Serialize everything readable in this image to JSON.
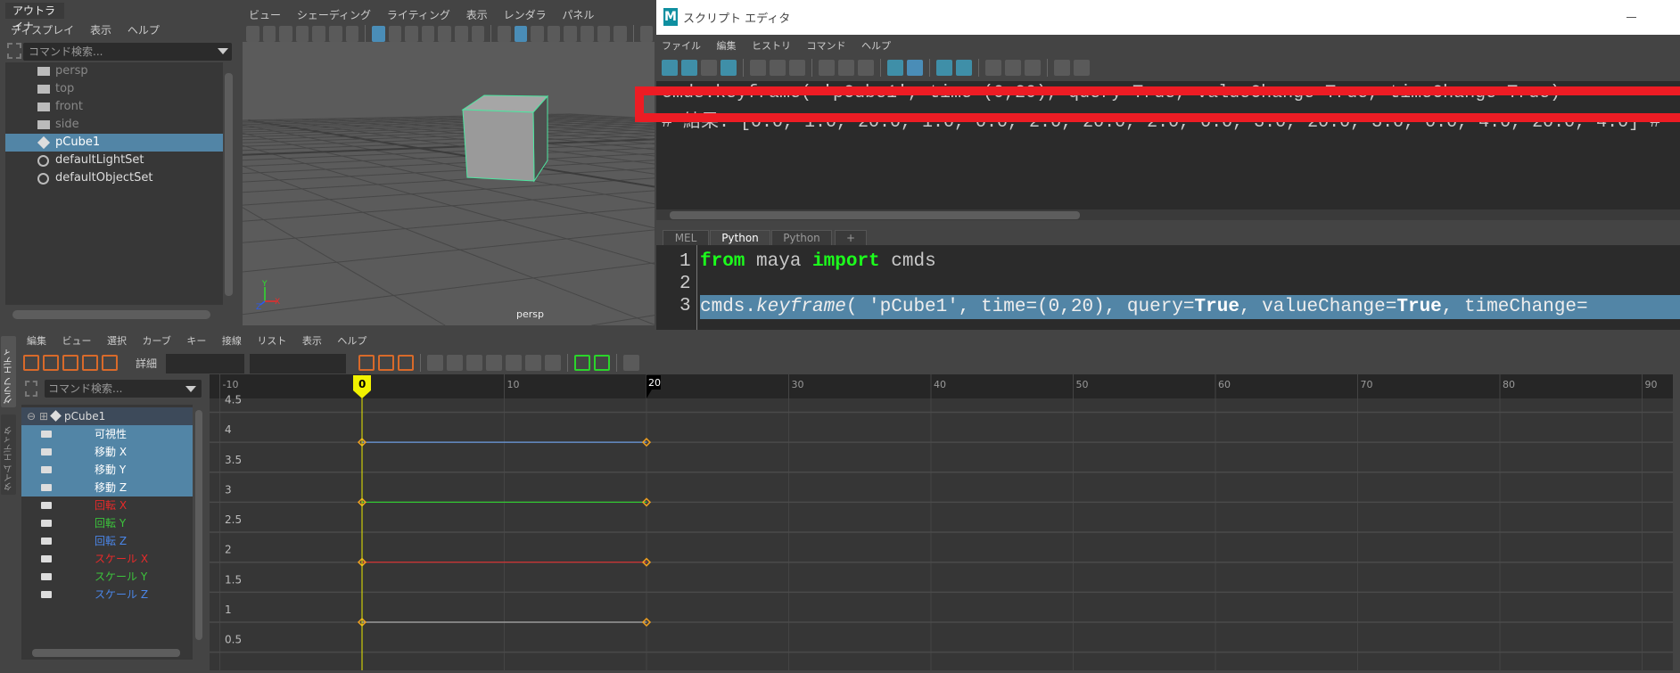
{
  "outliner": {
    "tab": "アウトライナ",
    "menu": [
      "ディスプレイ",
      "表示",
      "ヘルプ"
    ],
    "search_placeholder": "コマンド検索...",
    "items": [
      {
        "label": "persp",
        "icon": "camera-icon",
        "dim": true
      },
      {
        "label": "top",
        "icon": "camera-icon",
        "dim": true
      },
      {
        "label": "front",
        "icon": "camera-icon",
        "dim": true
      },
      {
        "label": "side",
        "icon": "camera-icon",
        "dim": true
      },
      {
        "label": "pCube1",
        "icon": "transform-icon",
        "selected": true
      },
      {
        "label": "defaultLightSet",
        "icon": "set-icon"
      },
      {
        "label": "defaultObjectSet",
        "icon": "set-icon"
      }
    ]
  },
  "viewport": {
    "menu": [
      "ビュー",
      "シェーディング",
      "ライティング",
      "表示",
      "レンダラ",
      "パネル"
    ],
    "camera_label": "persp",
    "axis_labels": [
      "Y",
      "Z",
      "X"
    ]
  },
  "script_editor": {
    "title": "スクリプト エディタ",
    "logo": "M",
    "menu": [
      "ファイル",
      "編集",
      "ヒストリ",
      "コマンド",
      "ヘルプ"
    ],
    "history": [
      "cmds.keyframe( 'pCube1', time=(0,20), query=True, valueChange=True, timeChange=True)",
      "# 結果: [0.0, 1.0, 20.0, 1.0, 0.0, 2.0, 20.0, 2.0, 0.0, 3.0, 20.0, 3.0, 0.0, 4.0, 20.0, 4.0] #"
    ],
    "highlight_color": "#ed1c24",
    "tabs": [
      {
        "label": "MEL"
      },
      {
        "label": "Python",
        "active": true
      },
      {
        "label": "Python"
      },
      {
        "label": "+"
      }
    ],
    "code": {
      "line_numbers": [
        "1",
        "2",
        "3"
      ],
      "line1": {
        "kw1": "from",
        "t1": " maya ",
        "kw2": "import",
        "t2": " cmds"
      },
      "line3": {
        "a": "cmds.",
        "b": "keyframe",
        "c": "( 'pCube1', time=(0,20), query=",
        "d": "True",
        "e": ", valueChange=",
        "f": "True",
        "g": ", timeChange="
      }
    }
  },
  "graph_editor": {
    "side_tabs": [
      "グラフ エディタ",
      "タイム エディタ"
    ],
    "menu": [
      "編集",
      "ビュー",
      "選択",
      "カーブ",
      "キー",
      "接線",
      "リスト",
      "表示",
      "ヘルプ"
    ],
    "detail_label": "詳細",
    "search_placeholder": "コマンド検索...",
    "node": "pCube1",
    "channels": [
      {
        "label": "可視性",
        "color": "#ffffff",
        "selected": true
      },
      {
        "label": "移動 X",
        "color": "#ffffff",
        "selected": true
      },
      {
        "label": "移動 Y",
        "color": "#ffffff",
        "selected": true
      },
      {
        "label": "移動 Z",
        "color": "#ffffff",
        "selected": true
      },
      {
        "label": "回転 X",
        "color": "#e82a2a"
      },
      {
        "label": "回転 Y",
        "color": "#3cc43c"
      },
      {
        "label": "回転 Z",
        "color": "#4a86e8"
      },
      {
        "label": "スケール X",
        "color": "#e82a2a"
      },
      {
        "label": "スケール Y",
        "color": "#3cc43c"
      },
      {
        "label": "スケール Z",
        "color": "#4a86e8"
      }
    ],
    "time_ticks": [
      "-10",
      "0",
      "10",
      "20",
      "30",
      "40",
      "50",
      "60",
      "70",
      "80",
      "90"
    ],
    "value_ticks": [
      "4.5",
      "4",
      "3.5",
      "3",
      "2.5",
      "2",
      "1.5",
      "1",
      "0.5"
    ],
    "current_time": "0",
    "end_time": "20",
    "curves": [
      {
        "value": 4,
        "keys": [
          0,
          20
        ],
        "color": "#6a9ae0"
      },
      {
        "value": 3,
        "keys": [
          0,
          20
        ],
        "color": "#32c832"
      },
      {
        "value": 2,
        "keys": [
          0,
          20
        ],
        "color": "#e03030"
      },
      {
        "value": 1,
        "keys": [
          0,
          20
        ],
        "color": "#a8a8a8"
      }
    ],
    "key_color": "#f0a020"
  }
}
